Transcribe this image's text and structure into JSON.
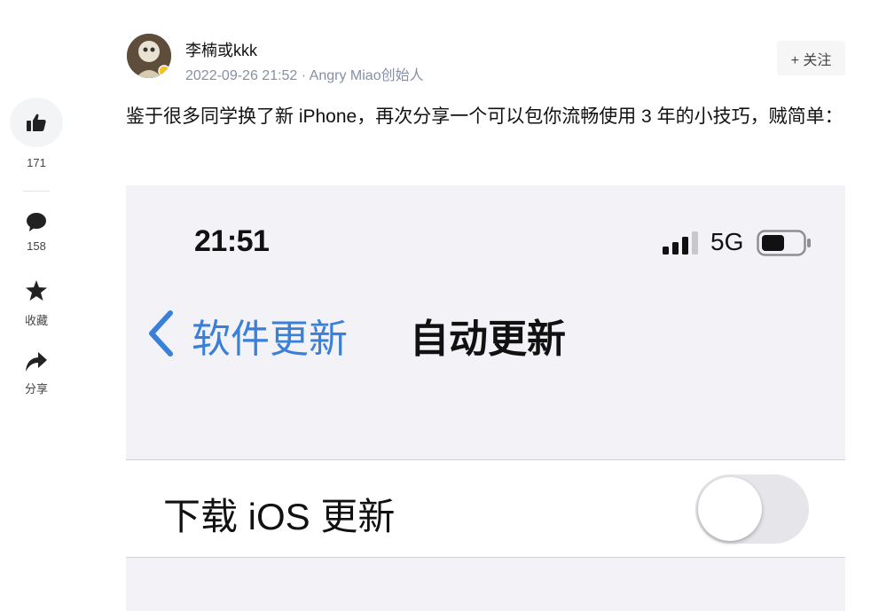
{
  "sidebar": {
    "like_count": "171",
    "comment_count": "158",
    "favorite_label": "收藏",
    "share_label": "分享",
    "icons": [
      "thumbs-up-icon",
      "comment-icon",
      "star-icon",
      "share-icon"
    ]
  },
  "author": {
    "name": "李楠或kkk",
    "meta": "2022-09-26 21:52 · Angry Miao创始人",
    "follow_label": "+ 关注"
  },
  "post": {
    "text": "鉴于很多同学换了新 iPhone，再次分享一个可以包你流畅使用 3 年的小技巧，贼简单："
  },
  "phone_screenshot": {
    "time": "21:51",
    "network": "5G",
    "back_label": "软件更新",
    "nav_title": "自动更新",
    "row_label": "下载 iOS 更新",
    "toggle_on": false
  },
  "colors": {
    "ios_blue": "#3a7fd8",
    "ios_background": "#f2f2f7",
    "meta_gray": "#8590a6"
  }
}
